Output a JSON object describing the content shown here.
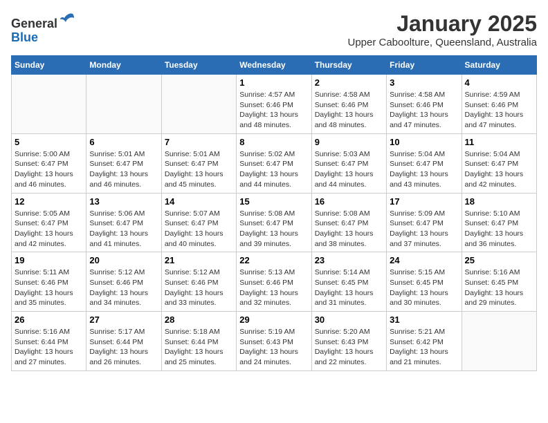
{
  "header": {
    "logo_line1": "General",
    "logo_line2": "Blue",
    "title": "January 2025",
    "subtitle": "Upper Caboolture, Queensland, Australia"
  },
  "days_of_week": [
    "Sunday",
    "Monday",
    "Tuesday",
    "Wednesday",
    "Thursday",
    "Friday",
    "Saturday"
  ],
  "weeks": [
    [
      {
        "day": "",
        "info": ""
      },
      {
        "day": "",
        "info": ""
      },
      {
        "day": "",
        "info": ""
      },
      {
        "day": "1",
        "info": "Sunrise: 4:57 AM\nSunset: 6:46 PM\nDaylight: 13 hours\nand 48 minutes."
      },
      {
        "day": "2",
        "info": "Sunrise: 4:58 AM\nSunset: 6:46 PM\nDaylight: 13 hours\nand 48 minutes."
      },
      {
        "day": "3",
        "info": "Sunrise: 4:58 AM\nSunset: 6:46 PM\nDaylight: 13 hours\nand 47 minutes."
      },
      {
        "day": "4",
        "info": "Sunrise: 4:59 AM\nSunset: 6:46 PM\nDaylight: 13 hours\nand 47 minutes."
      }
    ],
    [
      {
        "day": "5",
        "info": "Sunrise: 5:00 AM\nSunset: 6:47 PM\nDaylight: 13 hours\nand 46 minutes."
      },
      {
        "day": "6",
        "info": "Sunrise: 5:01 AM\nSunset: 6:47 PM\nDaylight: 13 hours\nand 46 minutes."
      },
      {
        "day": "7",
        "info": "Sunrise: 5:01 AM\nSunset: 6:47 PM\nDaylight: 13 hours\nand 45 minutes."
      },
      {
        "day": "8",
        "info": "Sunrise: 5:02 AM\nSunset: 6:47 PM\nDaylight: 13 hours\nand 44 minutes."
      },
      {
        "day": "9",
        "info": "Sunrise: 5:03 AM\nSunset: 6:47 PM\nDaylight: 13 hours\nand 44 minutes."
      },
      {
        "day": "10",
        "info": "Sunrise: 5:04 AM\nSunset: 6:47 PM\nDaylight: 13 hours\nand 43 minutes."
      },
      {
        "day": "11",
        "info": "Sunrise: 5:04 AM\nSunset: 6:47 PM\nDaylight: 13 hours\nand 42 minutes."
      }
    ],
    [
      {
        "day": "12",
        "info": "Sunrise: 5:05 AM\nSunset: 6:47 PM\nDaylight: 13 hours\nand 42 minutes."
      },
      {
        "day": "13",
        "info": "Sunrise: 5:06 AM\nSunset: 6:47 PM\nDaylight: 13 hours\nand 41 minutes."
      },
      {
        "day": "14",
        "info": "Sunrise: 5:07 AM\nSunset: 6:47 PM\nDaylight: 13 hours\nand 40 minutes."
      },
      {
        "day": "15",
        "info": "Sunrise: 5:08 AM\nSunset: 6:47 PM\nDaylight: 13 hours\nand 39 minutes."
      },
      {
        "day": "16",
        "info": "Sunrise: 5:08 AM\nSunset: 6:47 PM\nDaylight: 13 hours\nand 38 minutes."
      },
      {
        "day": "17",
        "info": "Sunrise: 5:09 AM\nSunset: 6:47 PM\nDaylight: 13 hours\nand 37 minutes."
      },
      {
        "day": "18",
        "info": "Sunrise: 5:10 AM\nSunset: 6:47 PM\nDaylight: 13 hours\nand 36 minutes."
      }
    ],
    [
      {
        "day": "19",
        "info": "Sunrise: 5:11 AM\nSunset: 6:46 PM\nDaylight: 13 hours\nand 35 minutes."
      },
      {
        "day": "20",
        "info": "Sunrise: 5:12 AM\nSunset: 6:46 PM\nDaylight: 13 hours\nand 34 minutes."
      },
      {
        "day": "21",
        "info": "Sunrise: 5:12 AM\nSunset: 6:46 PM\nDaylight: 13 hours\nand 33 minutes."
      },
      {
        "day": "22",
        "info": "Sunrise: 5:13 AM\nSunset: 6:46 PM\nDaylight: 13 hours\nand 32 minutes."
      },
      {
        "day": "23",
        "info": "Sunrise: 5:14 AM\nSunset: 6:45 PM\nDaylight: 13 hours\nand 31 minutes."
      },
      {
        "day": "24",
        "info": "Sunrise: 5:15 AM\nSunset: 6:45 PM\nDaylight: 13 hours\nand 30 minutes."
      },
      {
        "day": "25",
        "info": "Sunrise: 5:16 AM\nSunset: 6:45 PM\nDaylight: 13 hours\nand 29 minutes."
      }
    ],
    [
      {
        "day": "26",
        "info": "Sunrise: 5:16 AM\nSunset: 6:44 PM\nDaylight: 13 hours\nand 27 minutes."
      },
      {
        "day": "27",
        "info": "Sunrise: 5:17 AM\nSunset: 6:44 PM\nDaylight: 13 hours\nand 26 minutes."
      },
      {
        "day": "28",
        "info": "Sunrise: 5:18 AM\nSunset: 6:44 PM\nDaylight: 13 hours\nand 25 minutes."
      },
      {
        "day": "29",
        "info": "Sunrise: 5:19 AM\nSunset: 6:43 PM\nDaylight: 13 hours\nand 24 minutes."
      },
      {
        "day": "30",
        "info": "Sunrise: 5:20 AM\nSunset: 6:43 PM\nDaylight: 13 hours\nand 22 minutes."
      },
      {
        "day": "31",
        "info": "Sunrise: 5:21 AM\nSunset: 6:42 PM\nDaylight: 13 hours\nand 21 minutes."
      },
      {
        "day": "",
        "info": ""
      }
    ]
  ]
}
